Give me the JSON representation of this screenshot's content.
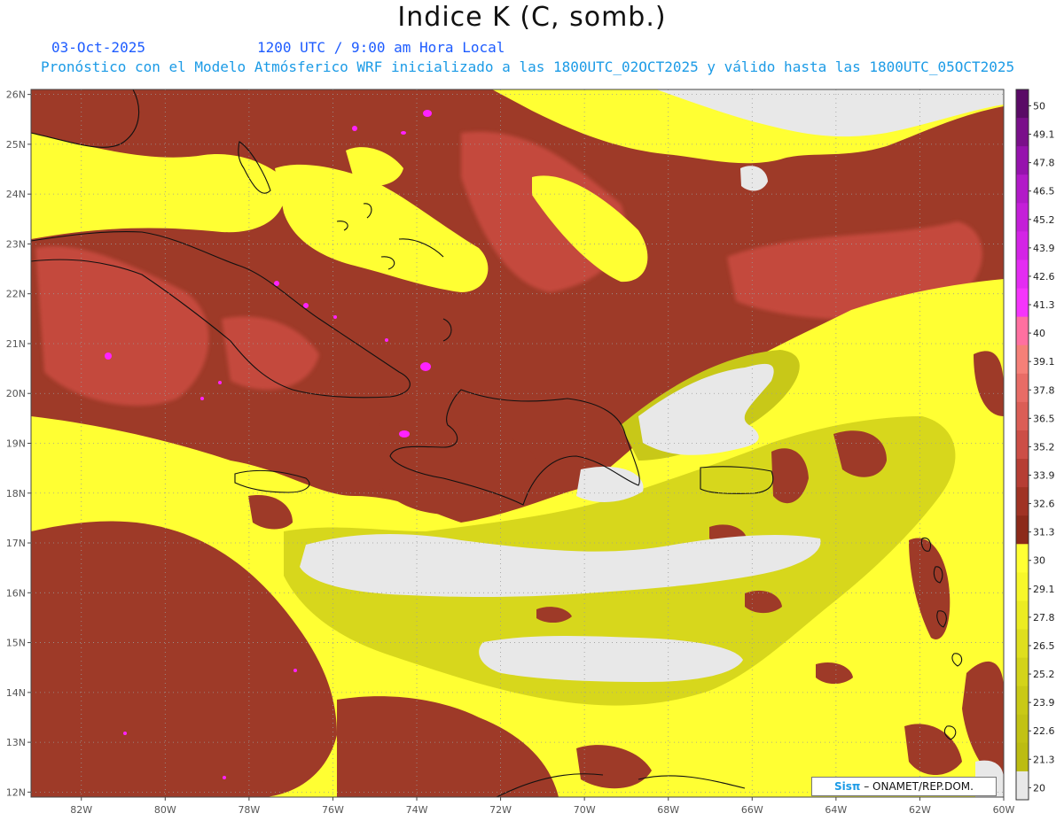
{
  "title": "Indice K (C, somb.)",
  "date": "03-Oct-2025",
  "time": "1200 UTC / 9:00 am Hora Local",
  "model_line": "Pronóstico con el Modelo Atmósferico WRF inicializado a las 1800UTC_02OCT2025 y válido hasta las  1800UTC_05OCT2025",
  "credit": {
    "brand": "Sisπ",
    "text": " – ONAMET/REP.DOM."
  },
  "map": {
    "lon_range": [
      -83.2,
      -60
    ],
    "lat_range": [
      11.9,
      26.1
    ],
    "lat_ticks": [
      {
        "v": 26,
        "label": "26N"
      },
      {
        "v": 25,
        "label": "25N"
      },
      {
        "v": 24,
        "label": "24N"
      },
      {
        "v": 23,
        "label": "23N"
      },
      {
        "v": 22,
        "label": "22N"
      },
      {
        "v": 21,
        "label": "21N"
      },
      {
        "v": 20,
        "label": "20N"
      },
      {
        "v": 19,
        "label": "19N"
      },
      {
        "v": 18,
        "label": "18N"
      },
      {
        "v": 17,
        "label": "17N"
      },
      {
        "v": 16,
        "label": "16N"
      },
      {
        "v": 15,
        "label": "15N"
      },
      {
        "v": 14,
        "label": "14N"
      },
      {
        "v": 13,
        "label": "13N"
      },
      {
        "v": 12,
        "label": "12N"
      }
    ],
    "lon_ticks": [
      {
        "v": -82,
        "label": "82W"
      },
      {
        "v": -80,
        "label": "80W"
      },
      {
        "v": -78,
        "label": "78W"
      },
      {
        "v": -76,
        "label": "76W"
      },
      {
        "v": -74,
        "label": "74W"
      },
      {
        "v": -72,
        "label": "72W"
      },
      {
        "v": -70,
        "label": "70W"
      },
      {
        "v": -68,
        "label": "68W"
      },
      {
        "v": -66,
        "label": "66W"
      },
      {
        "v": -64,
        "label": "64W"
      },
      {
        "v": -62,
        "label": "62W"
      },
      {
        "v": -60,
        "label": "60W"
      }
    ],
    "gridlines": "dotted"
  },
  "colorbar": {
    "labels": [
      "50",
      "49.1",
      "47.8",
      "46.5",
      "45.2",
      "43.9",
      "42.6",
      "41.3",
      "40",
      "39.1",
      "37.8",
      "36.5",
      "35.2",
      "33.9",
      "32.6",
      "31.3",
      "30",
      "29.1",
      "27.8",
      "26.5",
      "25.2",
      "23.9",
      "22.6",
      "21.3",
      "20"
    ],
    "colors": [
      "#5a0a66",
      "#7a0f8a",
      "#9612ad",
      "#b21ac8",
      "#c41fd8",
      "#d424e6",
      "#e42cf2",
      "#f535fb",
      "#ff70a0",
      "#f58078",
      "#e86c66",
      "#db5e56",
      "#cc4e46",
      "#b63e34",
      "#a03324",
      "#8c2a1a",
      "#ffff33",
      "#f7f72a",
      "#ecec22",
      "#dfdf1e",
      "#d3d31a",
      "#c9c916",
      "#c2c214",
      "#bcbc12",
      "#e8e8e8"
    ]
  },
  "field_colors": {
    "very_low": "#e8e8e8",
    "low": "#c8c818",
    "mid_low": "#eaea2a",
    "mid": "#ffff33",
    "moderate": "#9e3a28",
    "high": "#c94c40",
    "very_high": "#dc6258",
    "extreme": "#ff22ff"
  }
}
